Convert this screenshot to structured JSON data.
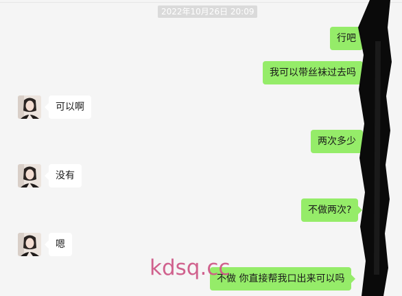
{
  "chat": {
    "timestamp": "2022年10月26日 20:09",
    "messages": [
      {
        "side": "out",
        "text": "行吧"
      },
      {
        "side": "out",
        "text": "我可以带丝袜过去吗"
      },
      {
        "side": "in",
        "text": "可以啊"
      },
      {
        "side": "out",
        "text": "两次多少"
      },
      {
        "side": "in",
        "text": "没有"
      },
      {
        "side": "out",
        "text": "不做两次?"
      },
      {
        "side": "in",
        "text": "嗯"
      },
      {
        "side": "out",
        "text": "不做  你直接帮我口出来可以吗"
      }
    ]
  },
  "watermark": "kdsq.cc",
  "colors": {
    "outgoing_bubble": "#95ec69",
    "incoming_bubble": "#ffffff",
    "background": "#f5f5f5",
    "timestamp_bg": "#dadada",
    "watermark": "#cf5a88"
  },
  "icons": {
    "contact_avatar": "avatar-photo"
  }
}
